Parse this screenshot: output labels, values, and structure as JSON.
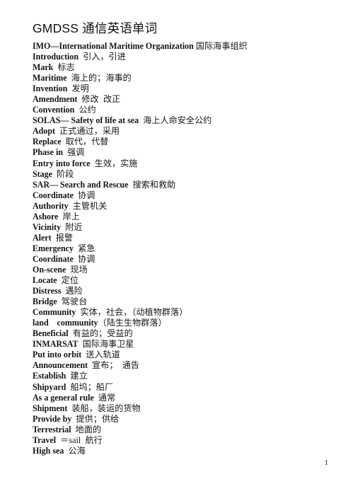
{
  "document": {
    "title": "GMDSS 通信英语单词",
    "page_number": "1",
    "entries": [
      {
        "term": "IMO—International Maritime Organization",
        "gloss": " 国际海事组织"
      },
      {
        "term": "Introduction",
        "gloss": "  引入，引进"
      },
      {
        "term": "Mark",
        "gloss": "  标志"
      },
      {
        "term": "Maritime",
        "gloss": "  海上的；海事的"
      },
      {
        "term": "Invention",
        "gloss": "  发明"
      },
      {
        "term": "Amendment",
        "gloss": "  修改  改正"
      },
      {
        "term": "Convention",
        "gloss": "  公约"
      },
      {
        "term": "SOLAS— Safety of life at sea",
        "gloss": "  海上人命安全公约"
      },
      {
        "term": "Adopt",
        "gloss": "  正式通过，采用"
      },
      {
        "term": "Replace",
        "gloss": "  取代，代替"
      },
      {
        "term": "Phase in",
        "gloss": "  强调"
      },
      {
        "term": "Entry into force",
        "gloss": "  生效，实施"
      },
      {
        "term": "Stage",
        "gloss": "  阶段"
      },
      {
        "term": "SAR— Search and Rescue",
        "gloss": "  搜索和救助"
      },
      {
        "term": "Coordinate",
        "gloss": "  协调"
      },
      {
        "term": "Authority",
        "gloss": "  主管机关"
      },
      {
        "term": "Ashore",
        "gloss": "  岸上"
      },
      {
        "term": "Vicinity",
        "gloss": "  附近"
      },
      {
        "term": "Alert",
        "gloss": "  报警"
      },
      {
        "term": "Emergency",
        "gloss": "  紧急"
      },
      {
        "term": "Coordinate",
        "gloss": "  协调"
      },
      {
        "term": "On-scene",
        "gloss": "  现场"
      },
      {
        "term": "Locate",
        "gloss": "  定位"
      },
      {
        "term": "Distress",
        "gloss": "  遇险"
      },
      {
        "term": "Bridge",
        "gloss": "  驾驶台"
      },
      {
        "term": "Community",
        "gloss": "  实体，社会，（动植物群落）"
      },
      {
        "term": "land    community",
        "gloss": "（陆生生物群落）"
      },
      {
        "term": "Beneficial",
        "gloss": "  有益的；受益的"
      },
      {
        "term": "INMARSAT",
        "gloss": "  国际海事卫星"
      },
      {
        "term": "Put into orbit",
        "gloss": "  送入轨道"
      },
      {
        "term": "Announcement",
        "gloss": "  宣布；  通告"
      },
      {
        "term": "Establish",
        "gloss": "  建立"
      },
      {
        "term": "Shipyard",
        "gloss": "  船坞；船厂"
      },
      {
        "term": "As a general rule",
        "gloss": "  通常"
      },
      {
        "term": "Shipment",
        "gloss": "  装船，装运的货物"
      },
      {
        "term": "Provide by",
        "gloss": "  提供；供给"
      },
      {
        "term": "Terrestrial",
        "gloss": "  地面的"
      },
      {
        "term": "Travel",
        "gloss": "  ＝sail  航行"
      },
      {
        "term": "High sea",
        "gloss": "  公海"
      }
    ]
  }
}
